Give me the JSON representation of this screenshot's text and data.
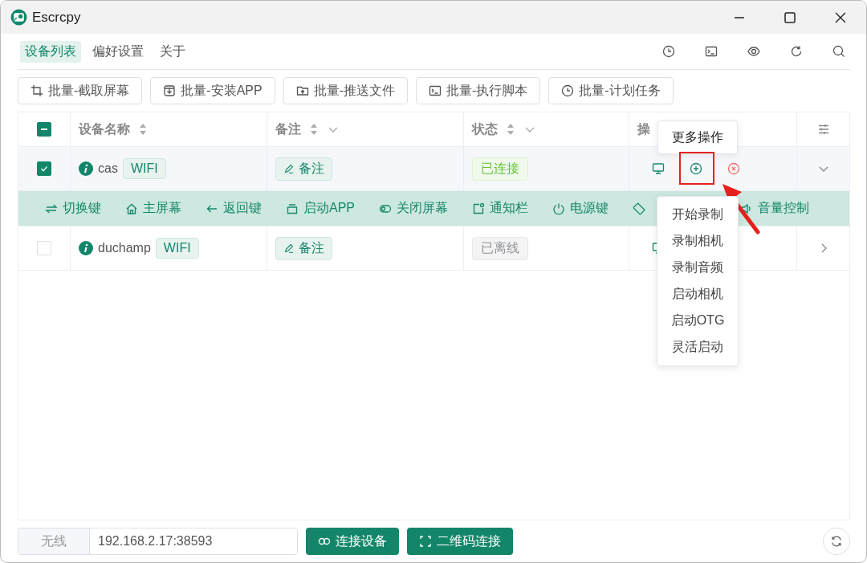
{
  "window": {
    "title": "Escrcpy"
  },
  "nav_tabs": [
    {
      "label": "设备列表",
      "selected": true
    },
    {
      "label": "偏好设置",
      "selected": false
    },
    {
      "label": "关于",
      "selected": false
    }
  ],
  "batch_buttons": [
    {
      "label": "批量-截取屏幕",
      "kind": "crop"
    },
    {
      "label": "批量-安装APP",
      "kind": "install"
    },
    {
      "label": "批量-推送文件",
      "kind": "folder"
    },
    {
      "label": "批量-执行脚本",
      "kind": "terminal"
    },
    {
      "label": "批量-计划任务",
      "kind": "clock"
    }
  ],
  "table": {
    "select_all": {
      "indeterminate": true
    },
    "columns": [
      {
        "label": "设备名称",
        "sortable": true,
        "filter": false
      },
      {
        "label": "备注",
        "sortable": true,
        "filter": true
      },
      {
        "label": "状态",
        "sortable": true,
        "filter": true
      },
      {
        "label": "操"
      }
    ],
    "rows": [
      {
        "checked": true,
        "name": "cas",
        "connection": "WIFI",
        "note_button": "备注",
        "status": "已连接",
        "connected": true,
        "expanded": true
      },
      {
        "checked": false,
        "name": "duchamp",
        "connection": "WIFI",
        "note_button": "备注",
        "status": "已离线",
        "connected": false,
        "expanded": false
      }
    ],
    "action_bar": [
      {
        "label": "切换键",
        "kind": "switch"
      },
      {
        "label": "主屏幕",
        "kind": "home"
      },
      {
        "label": "返回键",
        "kind": "back"
      },
      {
        "label": "启动APP",
        "kind": "app"
      },
      {
        "label": "关闭屏幕",
        "kind": "toggle"
      },
      {
        "label": "通知栏",
        "kind": "notify"
      },
      {
        "label": "电源键",
        "kind": "power"
      },
      {
        "kind": "rotate"
      },
      {
        "label": "音量控制",
        "kind": "volume"
      }
    ]
  },
  "tooltip": "更多操作",
  "more_menu": [
    "开始录制",
    "录制相机",
    "录制音频",
    "启动相机",
    "启动OTG",
    "灵活启动"
  ],
  "footer": {
    "mode": "无线",
    "address": "192.168.2.17:38593",
    "buttons": [
      {
        "label": "连接设备",
        "kind": "link"
      },
      {
        "label": "二维码连接",
        "kind": "scan"
      }
    ]
  }
}
